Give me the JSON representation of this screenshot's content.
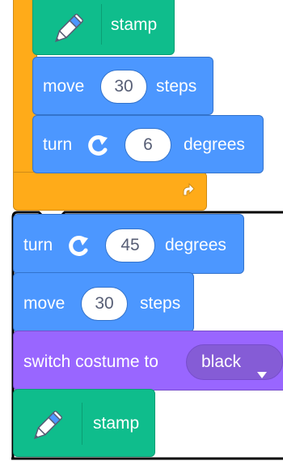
{
  "stack_top": {
    "pen_stamp": {
      "label": "stamp",
      "icon": "pen-icon"
    },
    "move": {
      "prefix": "move",
      "value": "30",
      "suffix": "steps"
    },
    "turn": {
      "prefix": "turn",
      "icon": "rotate-clockwise-icon",
      "value": "6",
      "suffix": "degrees"
    },
    "repeat_end": {
      "icon": "repeat-arrow-icon"
    }
  },
  "stack_bottom": {
    "turn": {
      "prefix": "turn",
      "icon": "rotate-clockwise-icon",
      "value": "45",
      "suffix": "degrees"
    },
    "move": {
      "prefix": "move",
      "value": "30",
      "suffix": "steps"
    },
    "costume": {
      "prefix": "switch costume to",
      "value": "black",
      "icon": "dropdown-arrow-icon"
    },
    "pen_stamp": {
      "label": "stamp",
      "icon": "pen-icon"
    }
  },
  "colors": {
    "motion": "#4c97ff",
    "pen": "#0fbd8c",
    "looks": "#9966ff",
    "control": "#ffab19"
  }
}
